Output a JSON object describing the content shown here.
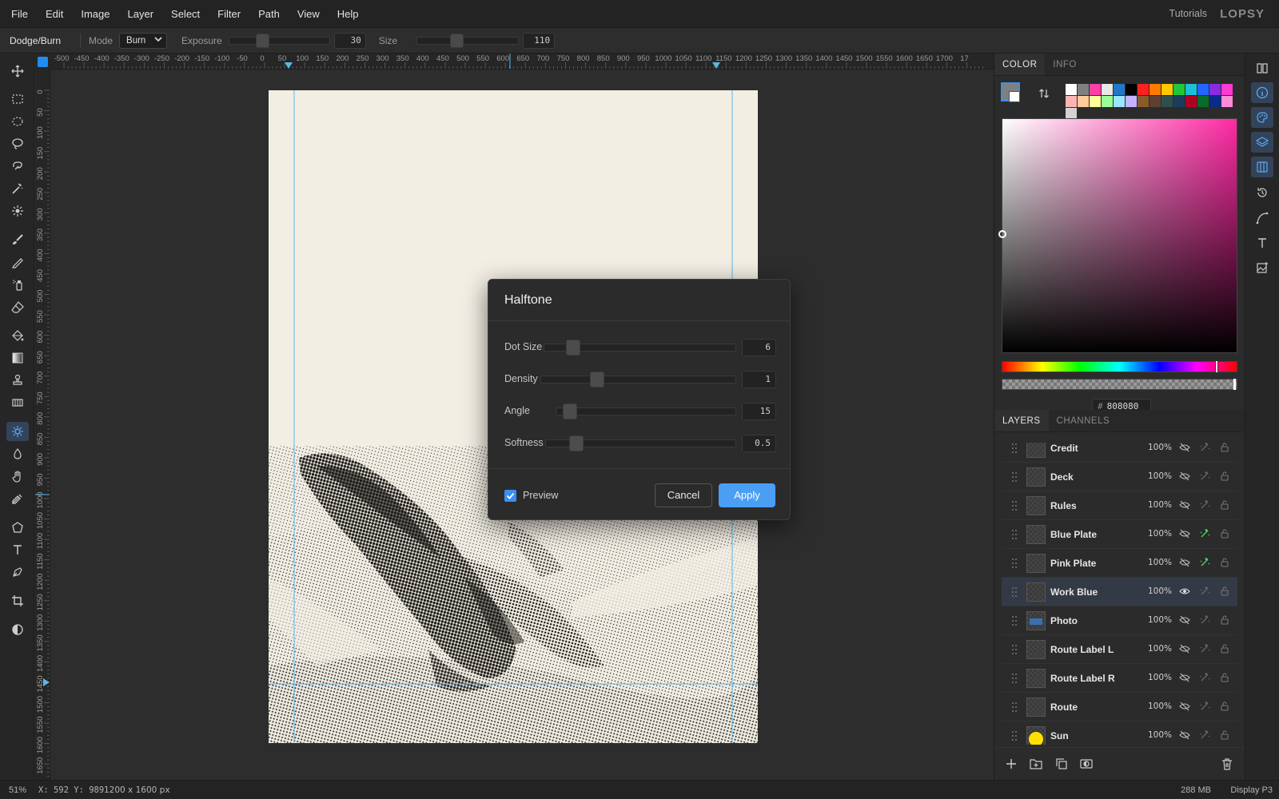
{
  "menu": [
    "File",
    "Edit",
    "Image",
    "Layer",
    "Select",
    "Filter",
    "Path",
    "View",
    "Help"
  ],
  "topRight": {
    "tutorials": "Tutorials",
    "logo": "LOPSY"
  },
  "options": {
    "tool": "Dodge/Burn",
    "mode_label": "Mode",
    "mode_value": "Burn",
    "exposure_label": "Exposure",
    "exposure_value": "30",
    "exposure_fraction": 0.3,
    "size_label": "Size",
    "size_value": "110",
    "size_fraction": 0.37
  },
  "rulers": {
    "top": [
      "-500",
      "-450",
      "-400",
      "-350",
      "-300",
      "-250",
      "-200",
      "-150",
      "-100",
      "-50",
      "0",
      "50",
      "100",
      "150",
      "200",
      "250",
      "300",
      "350",
      "400",
      "450",
      "500",
      "550",
      "600",
      "650",
      "700",
      "750",
      "800",
      "850",
      "900",
      "950",
      "1000",
      "1050",
      "1100",
      "1150",
      "1200",
      "1250",
      "1300",
      "1350",
      "1400",
      "1450",
      "1500",
      "1550",
      "1600",
      "1650",
      "1700",
      "17"
    ],
    "left": [
      "0",
      "50",
      "100",
      "150",
      "200",
      "250",
      "300",
      "350",
      "400",
      "450",
      "500",
      "550",
      "600",
      "650",
      "700",
      "750",
      "800",
      "850",
      "900",
      "950",
      "1000",
      "1050",
      "1100",
      "1150",
      "1200",
      "1250",
      "1300",
      "1350",
      "1400",
      "1450",
      "1500",
      "1550",
      "1600",
      "1650"
    ]
  },
  "dialog": {
    "title": "Halftone",
    "sliders": [
      {
        "label": "Dot Size",
        "value": "6",
        "fraction": 0.12
      },
      {
        "label": "Density",
        "value": "1",
        "fraction": 0.27
      },
      {
        "label": "Angle",
        "value": "15",
        "fraction": 0.04
      },
      {
        "label": "Softness",
        "value": "0.5",
        "fraction": 0.13
      }
    ],
    "preview_label": "Preview",
    "preview_checked": true,
    "cancel": "Cancel",
    "apply": "Apply"
  },
  "colorPanel": {
    "tabs": [
      "COLOR",
      "INFO"
    ],
    "active_tab": "COLOR",
    "foreground": "#808080",
    "background": "#ffffff",
    "swatches": [
      "#ffffff",
      "#808080",
      "#ff3fa6",
      "#e8e8e8",
      "#1f78c8",
      "#000000",
      "#ff2020",
      "#ff7a00",
      "#ffc800",
      "#22c63a",
      "#1bbfd9",
      "#2266ff",
      "#8a2be2",
      "#ff3ad0",
      "#ffb3b3",
      "#ffcc99",
      "#ffff99",
      "#99ff99",
      "#99e6ff",
      "#c5b3ff",
      "#8b5a2b",
      "#5c4033",
      "#2f4f4f",
      "#1a3d5c",
      "#b00020",
      "#0a6b2a",
      "#0a2a8c",
      "#ff8ad8",
      "#d3d3d3"
    ],
    "hex_label": "#",
    "hex_value": "808080"
  },
  "layersPanel": {
    "tabs": [
      "LAYERS",
      "CHANNELS"
    ],
    "active_tab": "LAYERS",
    "layers": [
      {
        "name": "Credit",
        "opacity": "100%",
        "visible": false,
        "fx": false,
        "selected": false
      },
      {
        "name": "Deck",
        "opacity": "100%",
        "visible": false,
        "fx": false,
        "selected": false
      },
      {
        "name": "Rules",
        "opacity": "100%",
        "visible": false,
        "fx": false,
        "selected": false
      },
      {
        "name": "Blue Plate",
        "opacity": "100%",
        "visible": false,
        "fx": true,
        "selected": false
      },
      {
        "name": "Pink Plate",
        "opacity": "100%",
        "visible": false,
        "fx": true,
        "selected": false
      },
      {
        "name": "Work Blue",
        "opacity": "100%",
        "visible": true,
        "fx": false,
        "selected": true
      },
      {
        "name": "Photo",
        "opacity": "100%",
        "visible": false,
        "fx": false,
        "selected": false
      },
      {
        "name": "Route Label L",
        "opacity": "100%",
        "visible": false,
        "fx": false,
        "selected": false
      },
      {
        "name": "Route Label R",
        "opacity": "100%",
        "visible": false,
        "fx": false,
        "selected": false
      },
      {
        "name": "Route",
        "opacity": "100%",
        "visible": false,
        "fx": false,
        "selected": false
      },
      {
        "name": "Sun",
        "opacity": "100%",
        "visible": false,
        "fx": false,
        "selected": false
      }
    ]
  },
  "status": {
    "zoom": "51%",
    "coords": "X: 592 Y: 989",
    "doc_size": "1200 x 1600 px",
    "memory": "288 MB",
    "profile": "Display P3"
  },
  "colors": {
    "accent": "#4a9ff5",
    "guide": "#5ab8e8",
    "paper": "#f2eee4",
    "ink": "#1c1a17"
  }
}
